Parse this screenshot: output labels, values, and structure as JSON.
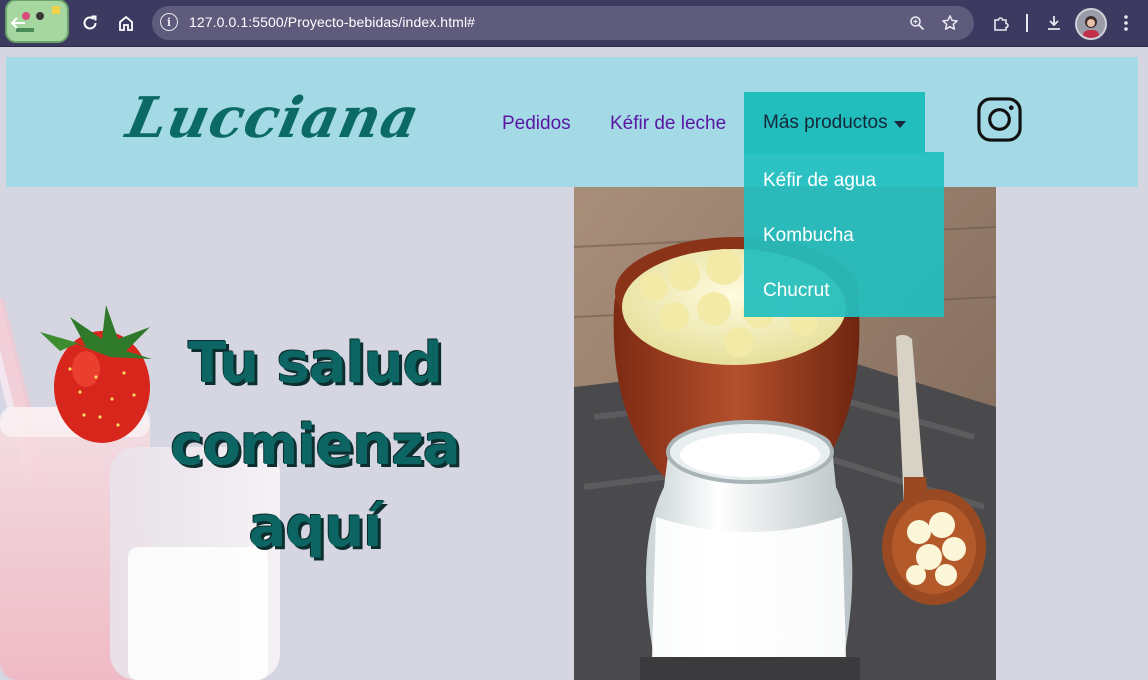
{
  "browser": {
    "url": "127.0.0.1:5500/Proyecto-bebidas/index.html#",
    "icons": {
      "back": "back-arrow-icon",
      "reload": "reload-icon",
      "home": "home-icon",
      "site_info": "info-icon",
      "zoom": "zoom-icon",
      "bookmark": "star-icon",
      "extensions": "puzzle-icon",
      "download": "download-icon",
      "menu": "kebab-menu-icon"
    },
    "colors": {
      "frame": "#3d3a61",
      "omnibox": "#5e5b7d"
    }
  },
  "site": {
    "logo": "Lucciana",
    "nav": {
      "pedidos": "Pedidos",
      "kefir_leche": "Kéfir de leche",
      "mas_productos": "Más productos"
    },
    "dropdown": [
      "Kéfir de agua",
      "Kombucha",
      "Chucrut"
    ],
    "social_icon": "instagram-icon",
    "hero": {
      "line1": "Tu salud",
      "line2": "comienza",
      "line3": "aquí"
    },
    "colors": {
      "header_bg": "#a3dae6",
      "accent": "#22bdbd",
      "logo": "#0b6a66",
      "nav_link": "#5a16a3",
      "headline": "#0c6563",
      "page_bg": "#d5d6e1"
    }
  }
}
